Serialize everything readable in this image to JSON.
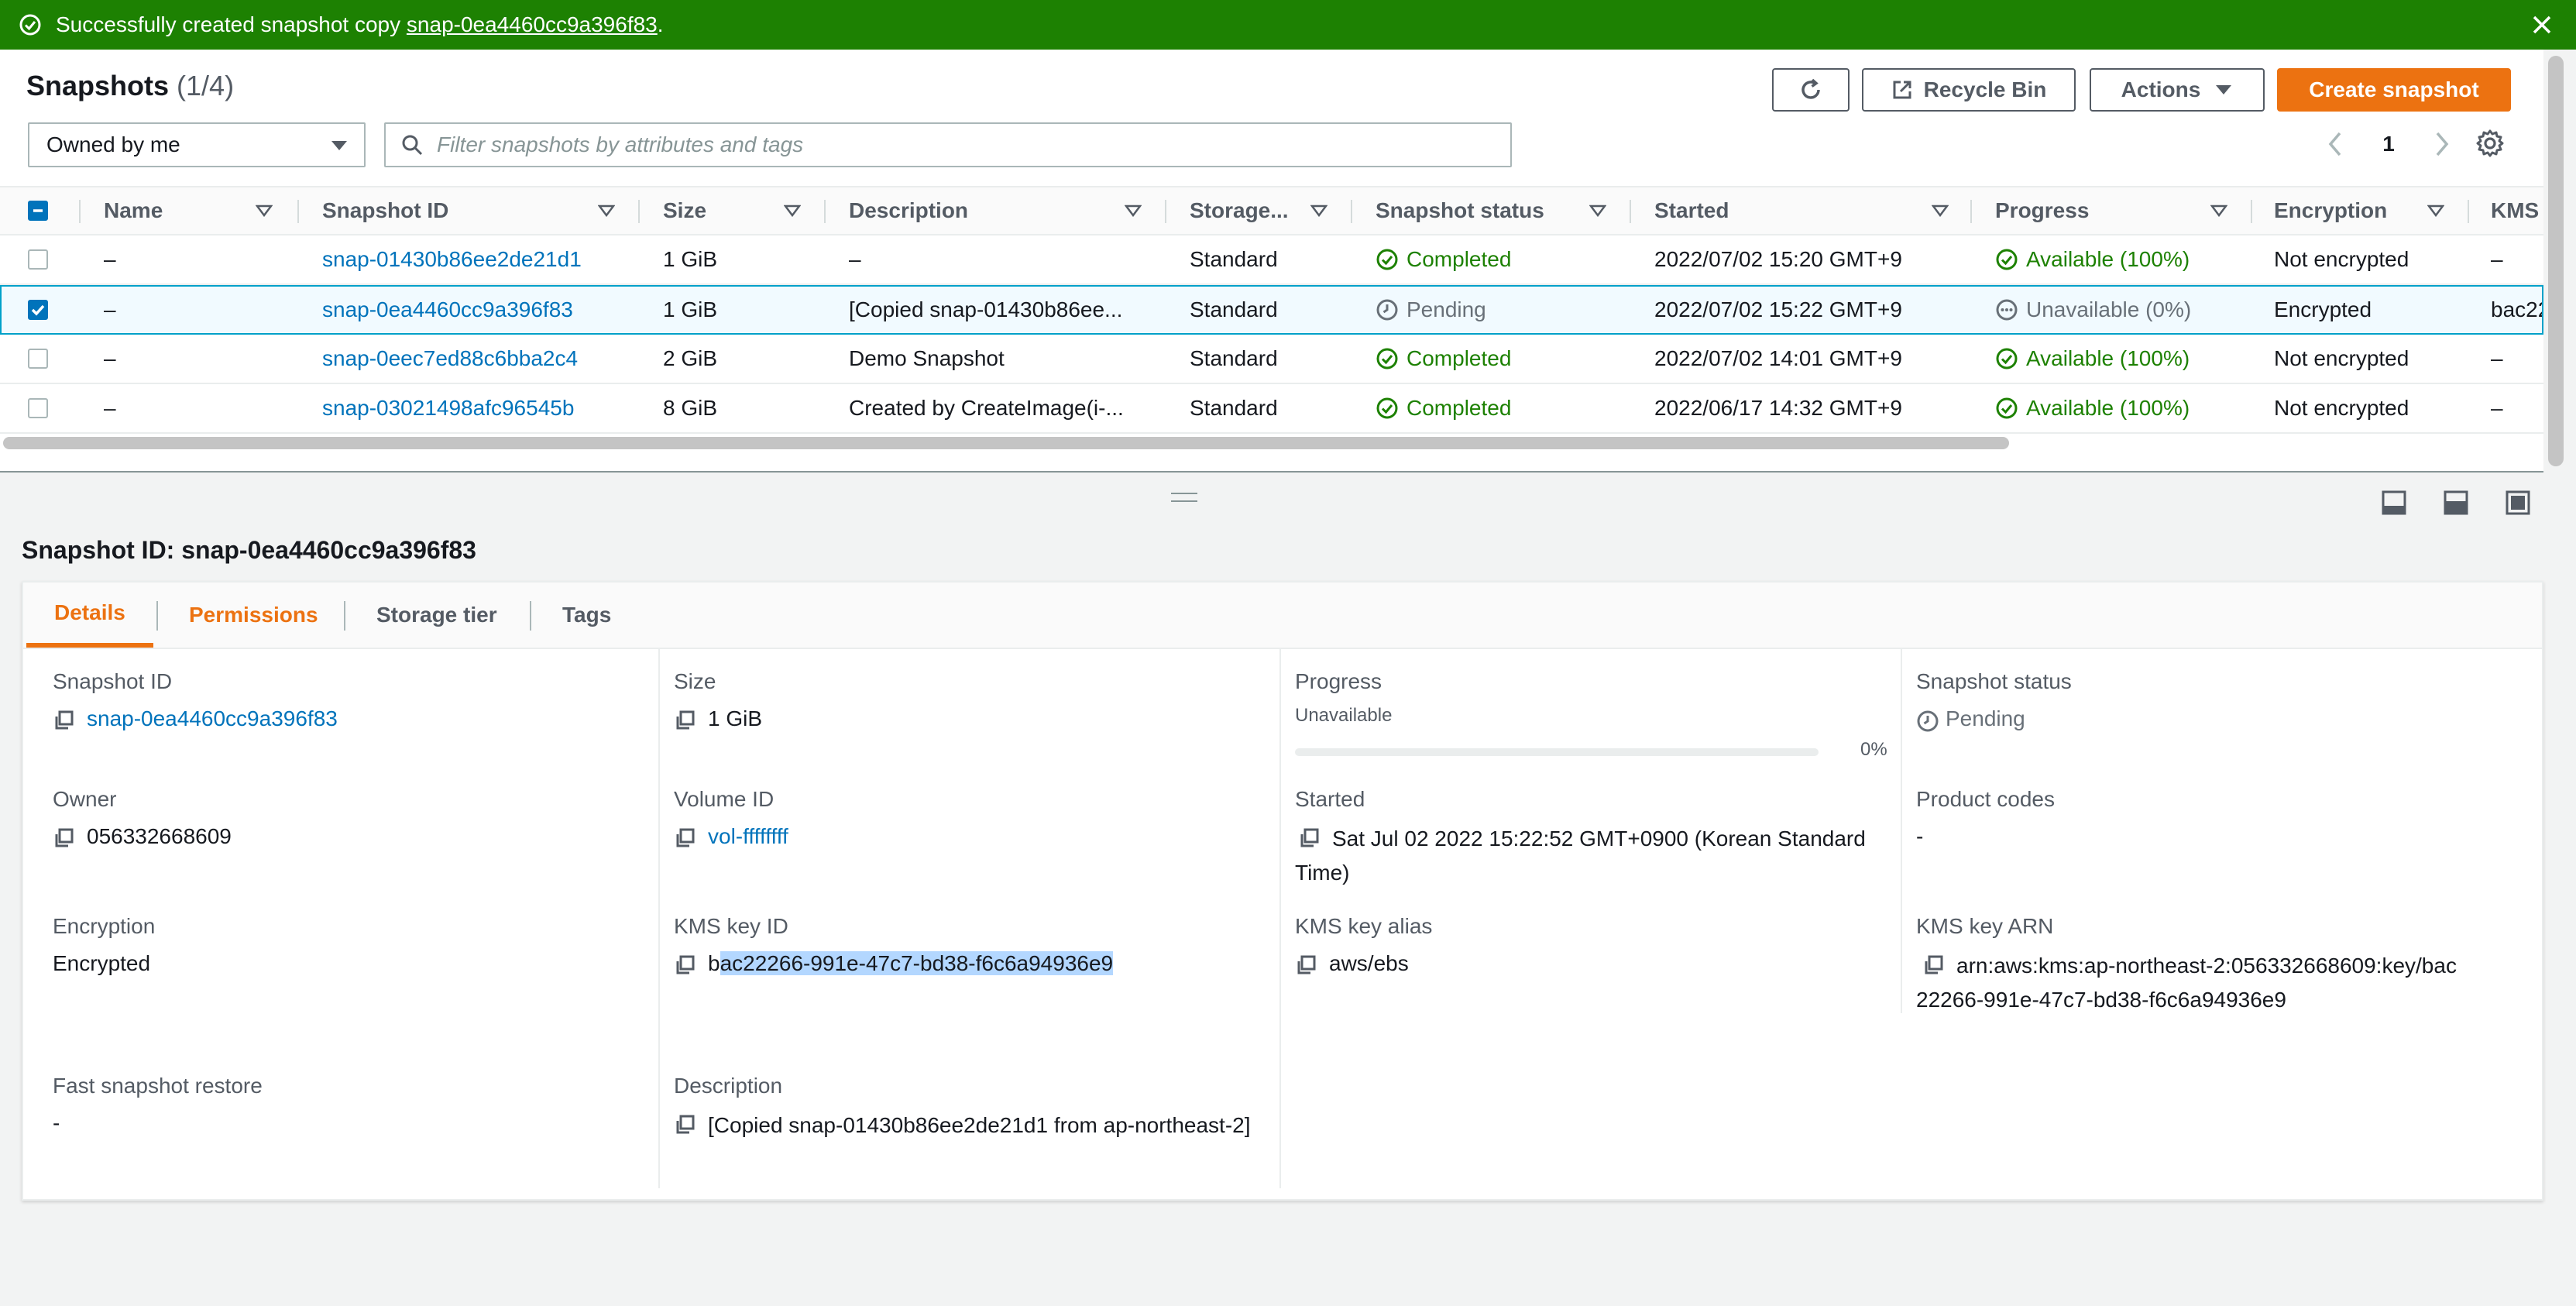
{
  "flash": {
    "message": "Successfully created snapshot copy",
    "snapshot_link": "snap-0ea4460cc9a396f83",
    "suffix": "."
  },
  "header": {
    "title": "Snapshots",
    "count": "(1/4)",
    "recycle_bin_label": "Recycle Bin",
    "actions_label": "Actions",
    "create_label": "Create snapshot"
  },
  "filter": {
    "owner_value": "Owned by me",
    "search_placeholder": "Filter snapshots by attributes and tags"
  },
  "pagination": {
    "page": "1"
  },
  "table": {
    "columns": {
      "name": "Name",
      "snapshot_id": "Snapshot ID",
      "size": "Size",
      "description": "Description",
      "storage": "Storage...",
      "status": "Snapshot status",
      "started": "Started",
      "progress": "Progress",
      "encryption": "Encryption",
      "kms": "KMS"
    },
    "rows": [
      {
        "selected": false,
        "name": "–",
        "snapshot_id": "snap-01430b86ee2de21d1",
        "size": "1 GiB",
        "description": "–",
        "storage": "Standard",
        "status": "Completed",
        "started": "2022/07/02 15:20 GMT+9",
        "progress": "Available (100%)",
        "encryption": "Not encrypted",
        "kms": "–"
      },
      {
        "selected": true,
        "name": "–",
        "snapshot_id": "snap-0ea4460cc9a396f83",
        "size": "1 GiB",
        "description": "[Copied snap-01430b86ee...",
        "storage": "Standard",
        "status": "Pending",
        "started": "2022/07/02 15:22 GMT+9",
        "progress": "Unavailable (0%)",
        "encryption": "Encrypted",
        "kms": "bac22"
      },
      {
        "selected": false,
        "name": "–",
        "snapshot_id": "snap-0eec7ed88c6bba2c4",
        "size": "2 GiB",
        "description": "Demo Snapshot",
        "storage": "Standard",
        "status": "Completed",
        "started": "2022/07/02 14:01 GMT+9",
        "progress": "Available (100%)",
        "encryption": "Not encrypted",
        "kms": "–"
      },
      {
        "selected": false,
        "name": "–",
        "snapshot_id": "snap-03021498afc96545b",
        "size": "8 GiB",
        "description": "Created by CreateImage(i-...",
        "storage": "Standard",
        "status": "Completed",
        "started": "2022/06/17 14:32 GMT+9",
        "progress": "Available (100%)",
        "encryption": "Not encrypted",
        "kms": "–"
      }
    ]
  },
  "details": {
    "title": "Snapshot ID: snap-0ea4460cc9a396f83",
    "tabs": [
      "Details",
      "Permissions",
      "Storage tier",
      "Tags"
    ],
    "snapshot_id_label": "Snapshot ID",
    "snapshot_id": "snap-0ea4460cc9a396f83",
    "size_label": "Size",
    "size": "1 GiB",
    "progress_label": "Progress",
    "progress_sub": "Unavailable",
    "progress_percent_text": "0%",
    "progress_value": 0,
    "status_label": "Snapshot status",
    "status": "Pending",
    "owner_label": "Owner",
    "owner": "056332668609",
    "volume_id_label": "Volume ID",
    "volume_id": "vol-ffffffff",
    "started_label": "Started",
    "started": "Sat Jul 02 2022 15:22:52 GMT+0900 (Korean Standard Time)",
    "product_codes_label": "Product codes",
    "product_codes": "-",
    "encryption_label": "Encryption",
    "encryption": "Encrypted",
    "kms_key_id_label": "KMS key ID",
    "kms_key_id_first": "b",
    "kms_key_id_rest": "ac22266-991e-47c7-bd38-f6c6a94936e9",
    "kms_alias_label": "KMS key alias",
    "kms_alias": "aws/ebs",
    "kms_arn_label": "KMS key ARN",
    "kms_arn": "arn:aws:kms:ap-northeast-2:056332668609:key/bac22266-991e-47c7-bd38-f6c6a94936e9",
    "fsr_label": "Fast snapshot restore",
    "fsr": "-",
    "description_label": "Description",
    "description": "[Copied snap-01430b86ee2de21d1 from ap-northeast-2]"
  },
  "colors": {
    "success": "#1d8102",
    "primary": "#ec7211",
    "link": "#0073bb"
  }
}
